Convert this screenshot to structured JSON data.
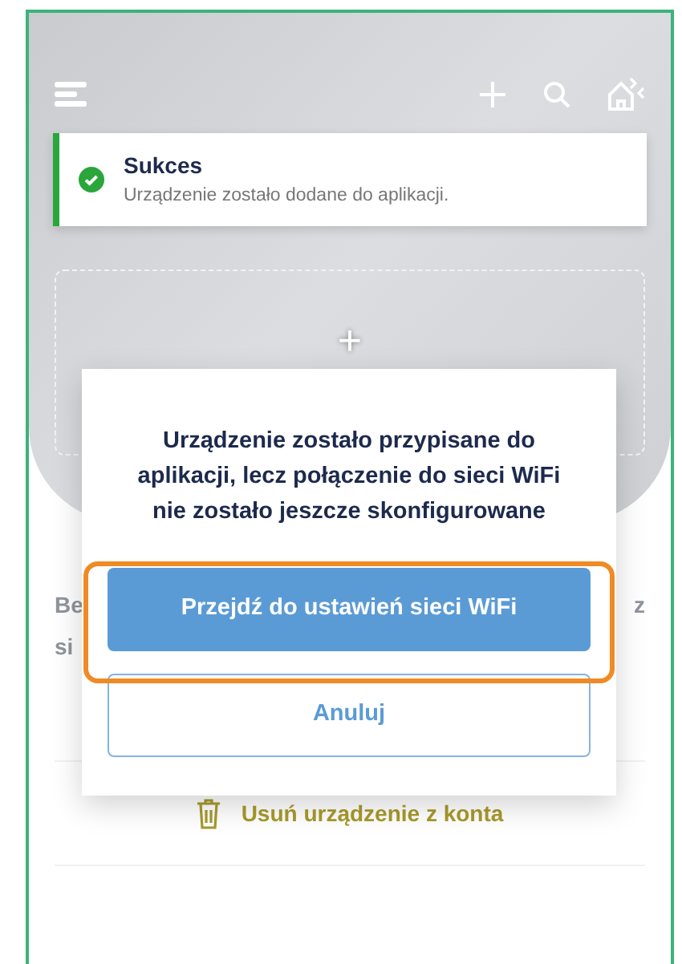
{
  "top_bar": {
    "buttons": [
      {
        "kind": "menu"
      },
      {
        "kind": "add"
      },
      {
        "kind": "search"
      },
      {
        "kind": "home"
      }
    ]
  },
  "toast": {
    "kind": "success",
    "title": "Sukces",
    "message": "Urządzenie zostało dodane do aplikacji."
  },
  "add_tile": {
    "label": "+"
  },
  "covered_text": {
    "line_1_start": "Be",
    "line_1_end": "z",
    "line_2_start": "si"
  },
  "delete_button": {
    "label": "Usuń urządzenie z konta",
    "disabled": true
  },
  "dialog": {
    "message": "Urządzenie zostało przypisane do aplikacji, lecz połączenie do sieci WiFi nie zostało jeszcze skonfigurowane",
    "primary_button": {
      "label": "Przejdź do ustawień sieci WiFi",
      "highlighted": true
    },
    "secondary_button": {
      "label": "Anuluj"
    }
  }
}
